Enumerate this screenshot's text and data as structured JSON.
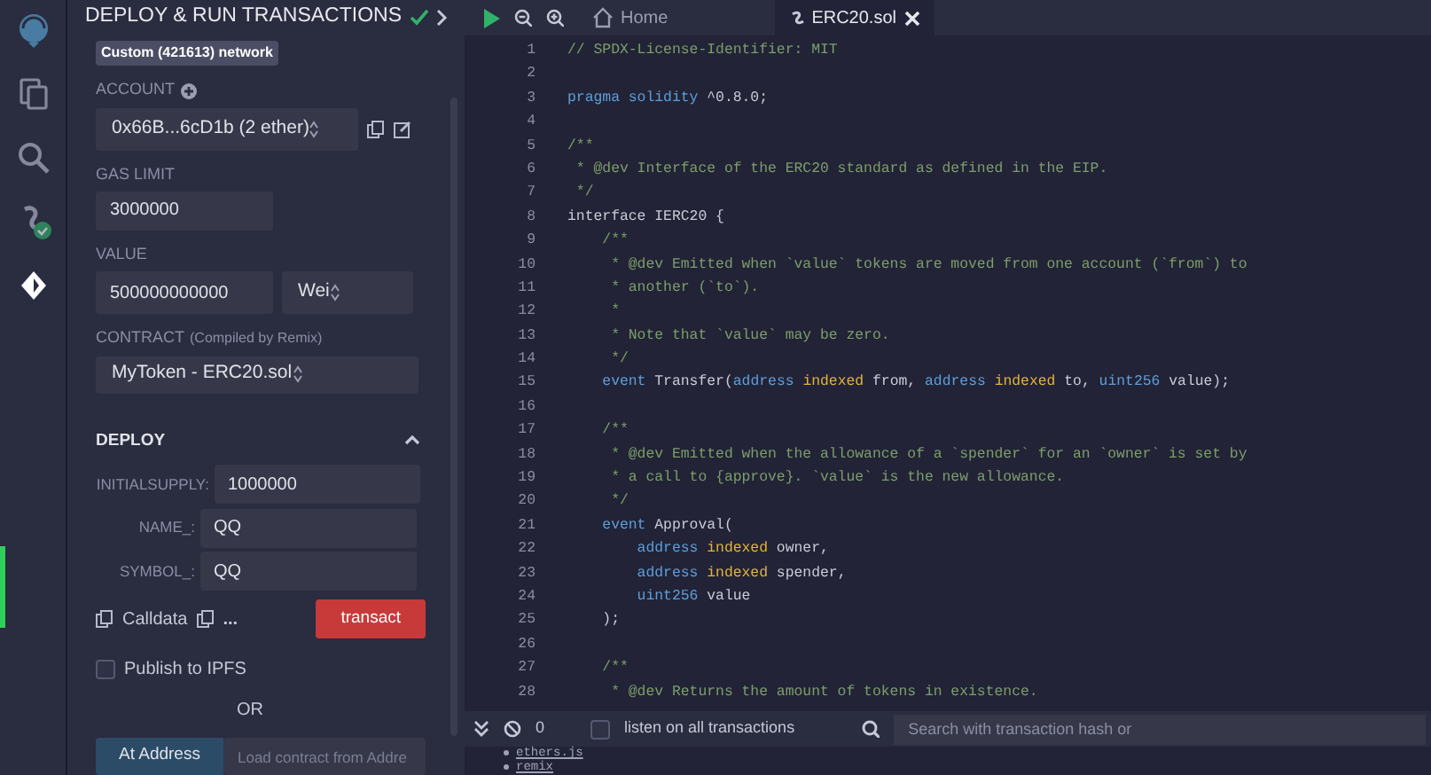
{
  "activity_bar": {
    "items": [
      {
        "kind": "logo",
        "selected": false
      },
      {
        "kind": "files",
        "selected": false
      },
      {
        "kind": "search",
        "selected": false
      },
      {
        "kind": "compiler",
        "selected": false
      },
      {
        "kind": "deploy",
        "selected": true
      }
    ]
  },
  "side_panel": {
    "title": "DEPLOY & RUN TRANSACTIONS",
    "network_tooltip": "Custom (421613) network",
    "account": {
      "label": "ACCOUNT",
      "value": "0x66B...6cD1b (2 ether)"
    },
    "gas_limit": {
      "label": "GAS LIMIT",
      "value": "3000000"
    },
    "value": {
      "label": "VALUE",
      "amount": "500000000000",
      "unit": "Wei"
    },
    "contract": {
      "label": "CONTRACT",
      "note": "(Compiled by Remix)",
      "value": "MyToken - ERC20.sol"
    },
    "deploy": {
      "title": "DEPLOY",
      "expanded": true,
      "params": [
        {
          "label": "INITIALSUPPLY:",
          "value": "1000000"
        },
        {
          "label": "NAME_:",
          "value": "QQ"
        },
        {
          "label": "SYMBOL_:",
          "value": "QQ"
        }
      ],
      "calldata": "Calldata",
      "more": "...",
      "transact": "transact"
    },
    "publish": {
      "label": "Publish to IPFS",
      "checked": false
    },
    "or": "OR",
    "at_address": "At Address",
    "load_placeholder": "Load contract from Addre"
  },
  "editor": {
    "tabs": [
      {
        "kind": "home",
        "label": "Home",
        "selected": false
      },
      {
        "kind": "file",
        "label": "ERC20.sol",
        "selected": true
      }
    ],
    "lines": [
      {
        "number": "1",
        "tokens": [
          {
            "kind": "comment",
            "text": "// SPDX-License-Identifier: MIT"
          }
        ]
      },
      {
        "number": "2"
      },
      {
        "number": "3",
        "tokens": [
          {
            "kind": "keyword",
            "text": "pragma solidity"
          },
          {
            "kind": "plain",
            "text": " ^0.8.0;"
          }
        ]
      },
      {
        "number": "4"
      },
      {
        "number": "5",
        "tokens": [
          {
            "kind": "comment",
            "text": "/**"
          }
        ]
      },
      {
        "number": "6",
        "tokens": [
          {
            "kind": "comment",
            "text": " * @dev Interface of the ERC20 standard as defined in the EIP."
          }
        ]
      },
      {
        "number": "7",
        "tokens": [
          {
            "kind": "comment",
            "text": " */"
          }
        ]
      },
      {
        "number": "8",
        "tokens": [
          {
            "kind": "plain",
            "text": "interface IERC20 {"
          }
        ]
      },
      {
        "number": "9",
        "tokens": [
          {
            "kind": "comment",
            "text": "    /**"
          }
        ]
      },
      {
        "number": "10",
        "tokens": [
          {
            "kind": "comment",
            "text": "     * @dev Emitted when `value` tokens are moved from one account (`from`) to"
          }
        ]
      },
      {
        "number": "11",
        "tokens": [
          {
            "kind": "comment",
            "text": "     * another (`to`)."
          }
        ]
      },
      {
        "number": "12",
        "tokens": [
          {
            "kind": "comment",
            "text": "     *"
          }
        ]
      },
      {
        "number": "13",
        "tokens": [
          {
            "kind": "comment",
            "text": "     * Note that `value` may be zero."
          }
        ]
      },
      {
        "number": "14",
        "tokens": [
          {
            "kind": "comment",
            "text": "     */"
          }
        ]
      },
      {
        "number": "15",
        "tokens": [
          {
            "kind": "keyword",
            "text": "    event"
          },
          {
            "kind": "plain",
            "text": " Transfer("
          },
          {
            "kind": "keyword",
            "text": "address"
          },
          {
            "kind": "modifier",
            "text": " indexed"
          },
          {
            "kind": "plain",
            "text": " from, "
          },
          {
            "kind": "keyword",
            "text": "address"
          },
          {
            "kind": "modifier",
            "text": " indexed"
          },
          {
            "kind": "plain",
            "text": " to, "
          },
          {
            "kind": "keyword",
            "text": "uint256"
          },
          {
            "kind": "plain",
            "text": " value);"
          }
        ]
      },
      {
        "number": "16"
      },
      {
        "number": "17",
        "tokens": [
          {
            "kind": "comment",
            "text": "    /**"
          }
        ]
      },
      {
        "number": "18",
        "tokens": [
          {
            "kind": "comment",
            "text": "     * @dev Emitted when the allowance of a `spender` for an `owner` is set by"
          }
        ]
      },
      {
        "number": "19",
        "tokens": [
          {
            "kind": "comment",
            "text": "     * a call to {approve}. `value` is the new allowance."
          }
        ]
      },
      {
        "number": "20",
        "tokens": [
          {
            "kind": "comment",
            "text": "     */"
          }
        ]
      },
      {
        "number": "21",
        "tokens": [
          {
            "kind": "keyword",
            "text": "    event"
          },
          {
            "kind": "plain",
            "text": " Approval("
          }
        ]
      },
      {
        "number": "22",
        "tokens": [
          {
            "kind": "keyword",
            "text": "        address"
          },
          {
            "kind": "modifier",
            "text": " indexed"
          },
          {
            "kind": "plain",
            "text": " owner,"
          }
        ]
      },
      {
        "number": "23",
        "tokens": [
          {
            "kind": "keyword",
            "text": "        address"
          },
          {
            "kind": "modifier",
            "text": " indexed"
          },
          {
            "kind": "plain",
            "text": " spender,"
          }
        ]
      },
      {
        "number": "24",
        "tokens": [
          {
            "kind": "keyword",
            "text": "        uint256"
          },
          {
            "kind": "plain",
            "text": " value"
          }
        ]
      },
      {
        "number": "25",
        "tokens": [
          {
            "kind": "plain",
            "text": "    );"
          }
        ]
      },
      {
        "number": "26"
      },
      {
        "number": "27",
        "tokens": [
          {
            "kind": "comment",
            "text": "    /**"
          }
        ]
      },
      {
        "number": "28",
        "tokens": [
          {
            "kind": "comment",
            "text": "     * @dev Returns the amount of tokens in existence."
          }
        ]
      }
    ]
  },
  "terminal": {
    "count": "0",
    "listen": {
      "label": "listen on all transactions",
      "checked": false
    },
    "search_placeholder": "Search with transaction hash or",
    "log": [
      "ethers.js",
      "remix"
    ]
  }
}
